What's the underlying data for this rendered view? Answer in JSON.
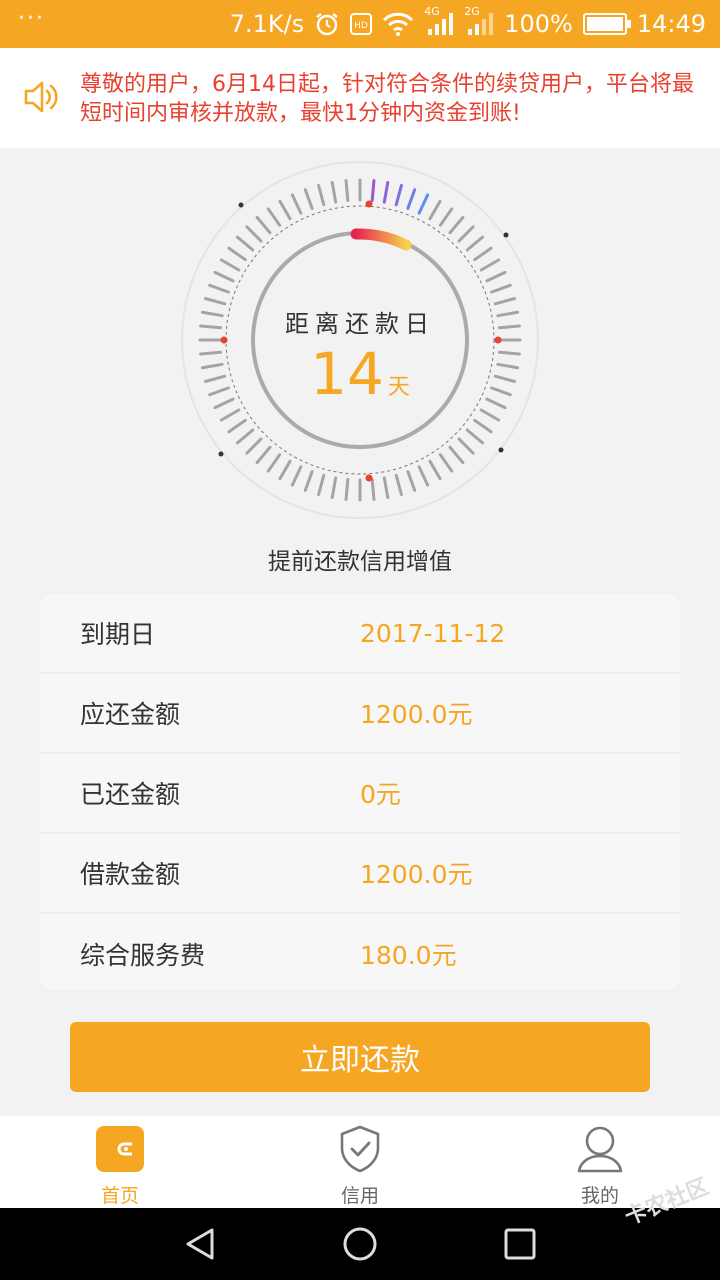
{
  "status_bar": {
    "menu_dots": "···",
    "net_speed": "7.1K/s",
    "net_4g": "4G",
    "net_2g": "2G",
    "battery": "100%",
    "time": "14:49"
  },
  "notice": {
    "text": "尊敬的用户，6月14日起，针对符合条件的续贷用户，平台将最短时间内审核并放款，最快1分钟内资金到账!"
  },
  "dial": {
    "title": "距离还款日",
    "days": "14",
    "unit": "天"
  },
  "caption": "提前还款信用增值",
  "details": [
    {
      "label": "到期日",
      "value": "2017-11-12"
    },
    {
      "label": "应还金额",
      "value": "1200.0元"
    },
    {
      "label": "已还金额",
      "value": "0元"
    },
    {
      "label": "借款金额",
      "value": "1200.0元"
    },
    {
      "label": "综合服务费",
      "value": "180.0元"
    }
  ],
  "pay_button": "立即还款",
  "tabs": [
    {
      "label": "首页",
      "icon": "wallet-icon",
      "active": true
    },
    {
      "label": "信用",
      "icon": "shield-check-icon",
      "active": false
    },
    {
      "label": "我的",
      "icon": "user-icon",
      "active": false
    }
  ],
  "watermark": "卡农社区",
  "colors": {
    "brand": "#f5a623",
    "notice_text": "#e8412f"
  }
}
